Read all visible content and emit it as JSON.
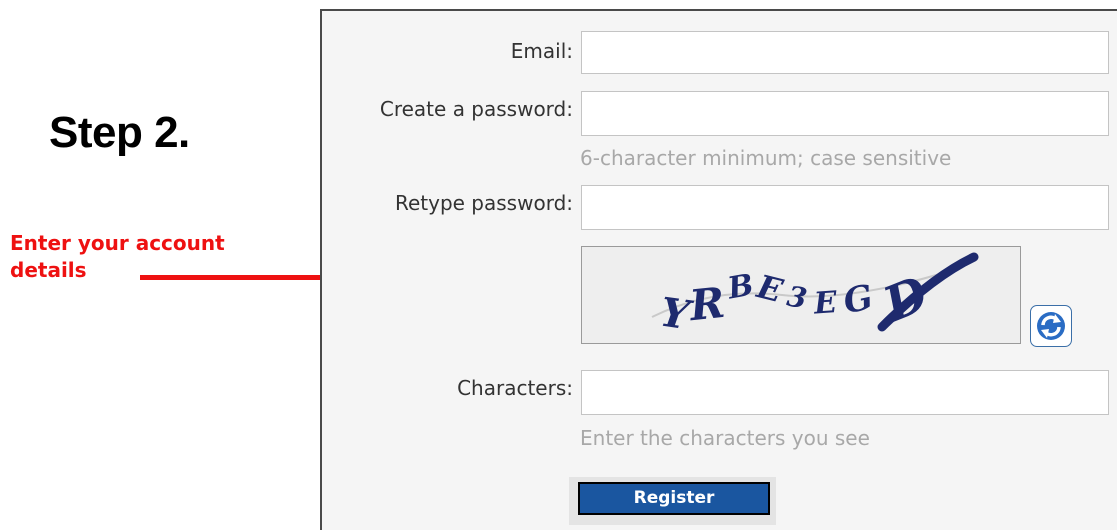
{
  "step": {
    "title": "Step 2."
  },
  "annotation": {
    "line1": "Enter your account",
    "line2": "details",
    "color": "#ee1111"
  },
  "form": {
    "email": {
      "label": "Email:",
      "value": ""
    },
    "password": {
      "label": "Create a password:",
      "value": "",
      "hint": "6-character minimum; case sensitive"
    },
    "retype": {
      "label": "Retype password:",
      "value": ""
    },
    "captcha": {
      "text": "YRBE3EGD",
      "refresh_icon": "refresh-icon"
    },
    "characters": {
      "label": "Characters:",
      "value": "",
      "hint": "Enter the characters you see"
    },
    "register_label": "Register"
  },
  "colors": {
    "panel_bg": "#f5f5f5",
    "button_bg": "#1a56a0",
    "hint_text": "#a8a8a8",
    "captcha_ink": "#1e2a6e"
  }
}
